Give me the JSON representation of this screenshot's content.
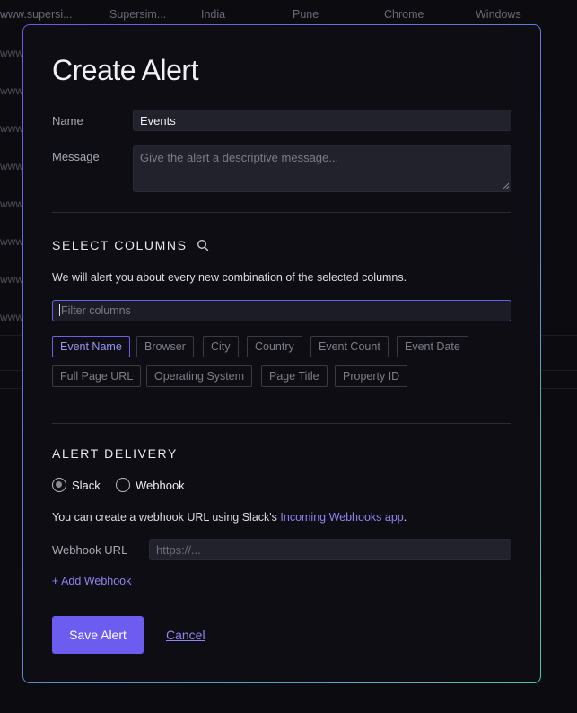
{
  "background": {
    "row": [
      "www.supersi...",
      "Supersim...",
      "India",
      "Pune",
      "Chrome",
      "Windows"
    ],
    "side_text": "www"
  },
  "modal": {
    "title": "Create Alert",
    "name_label": "Name",
    "name_value": "Events",
    "message_label": "Message",
    "message_placeholder": "Give the alert a descriptive message...",
    "select_columns": {
      "heading": "SELECT COLUMNS",
      "description": "We will alert you about every new combination of the selected columns.",
      "filter_placeholder": "Filter columns",
      "chips": [
        {
          "label": "Event Name",
          "selected": true
        },
        {
          "label": "Browser",
          "selected": false
        },
        {
          "label": "City",
          "selected": false
        },
        {
          "label": "Country",
          "selected": false
        },
        {
          "label": "Event Count",
          "selected": false
        },
        {
          "label": "Event Date",
          "selected": false
        },
        {
          "label": "Full Page URL",
          "selected": false
        },
        {
          "label": "Operating System",
          "selected": false
        },
        {
          "label": "Page Title",
          "selected": false
        },
        {
          "label": "Property ID",
          "selected": false
        }
      ]
    },
    "alert_delivery": {
      "heading": "ALERT DELIVERY",
      "options": [
        {
          "label": "Slack",
          "selected": true
        },
        {
          "label": "Webhook",
          "selected": false
        }
      ],
      "info_prefix": "You can create a webhook URL using Slack's ",
      "info_link": "Incoming Webhooks app",
      "info_suffix": ".",
      "webhook_label": "Webhook URL",
      "webhook_placeholder": "https://...",
      "add_webhook": "+ Add Webhook"
    },
    "save_label": "Save Alert",
    "cancel_label": "Cancel"
  },
  "colors": {
    "accent": "#6c5cf0",
    "link": "#8f85f0",
    "background": "#0b0b10"
  }
}
